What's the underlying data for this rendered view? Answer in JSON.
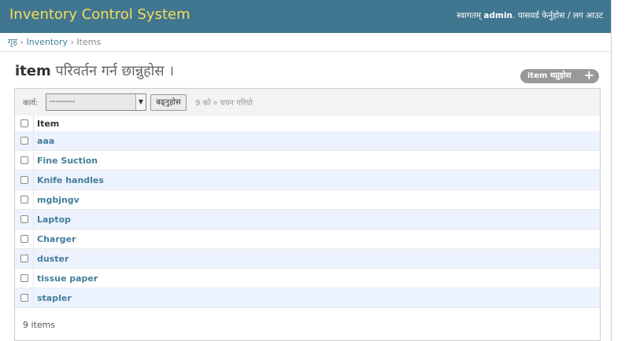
{
  "header": {
    "brand": "Inventory Control System",
    "welcome": "स्वागतम्",
    "username": "admin",
    "change_password": "पासवर्ड फेर्नुहोस",
    "separator": "/",
    "logout": "लग आउट"
  },
  "breadcrumbs": {
    "home": "गृह",
    "sep": "›",
    "app": "Inventory",
    "model": "Items"
  },
  "page": {
    "title_model": "item",
    "title_rest": "परिवर्तन गर्न छान्नुहोस ।",
    "add_label": "item थप्नुहोस"
  },
  "actions": {
    "label": "कार्य:",
    "selected_value": "---------",
    "go_label": "बढ्नुहोस",
    "counter": "9 को ० चयन गरियो"
  },
  "table": {
    "column": "Item",
    "rows": [
      "aaa",
      "Fine Suction",
      "Knife handles",
      "mgbjngv",
      "Laptop",
      "Charger",
      "duster",
      "tissue paper",
      "stapler"
    ]
  },
  "paginator": "9 items"
}
